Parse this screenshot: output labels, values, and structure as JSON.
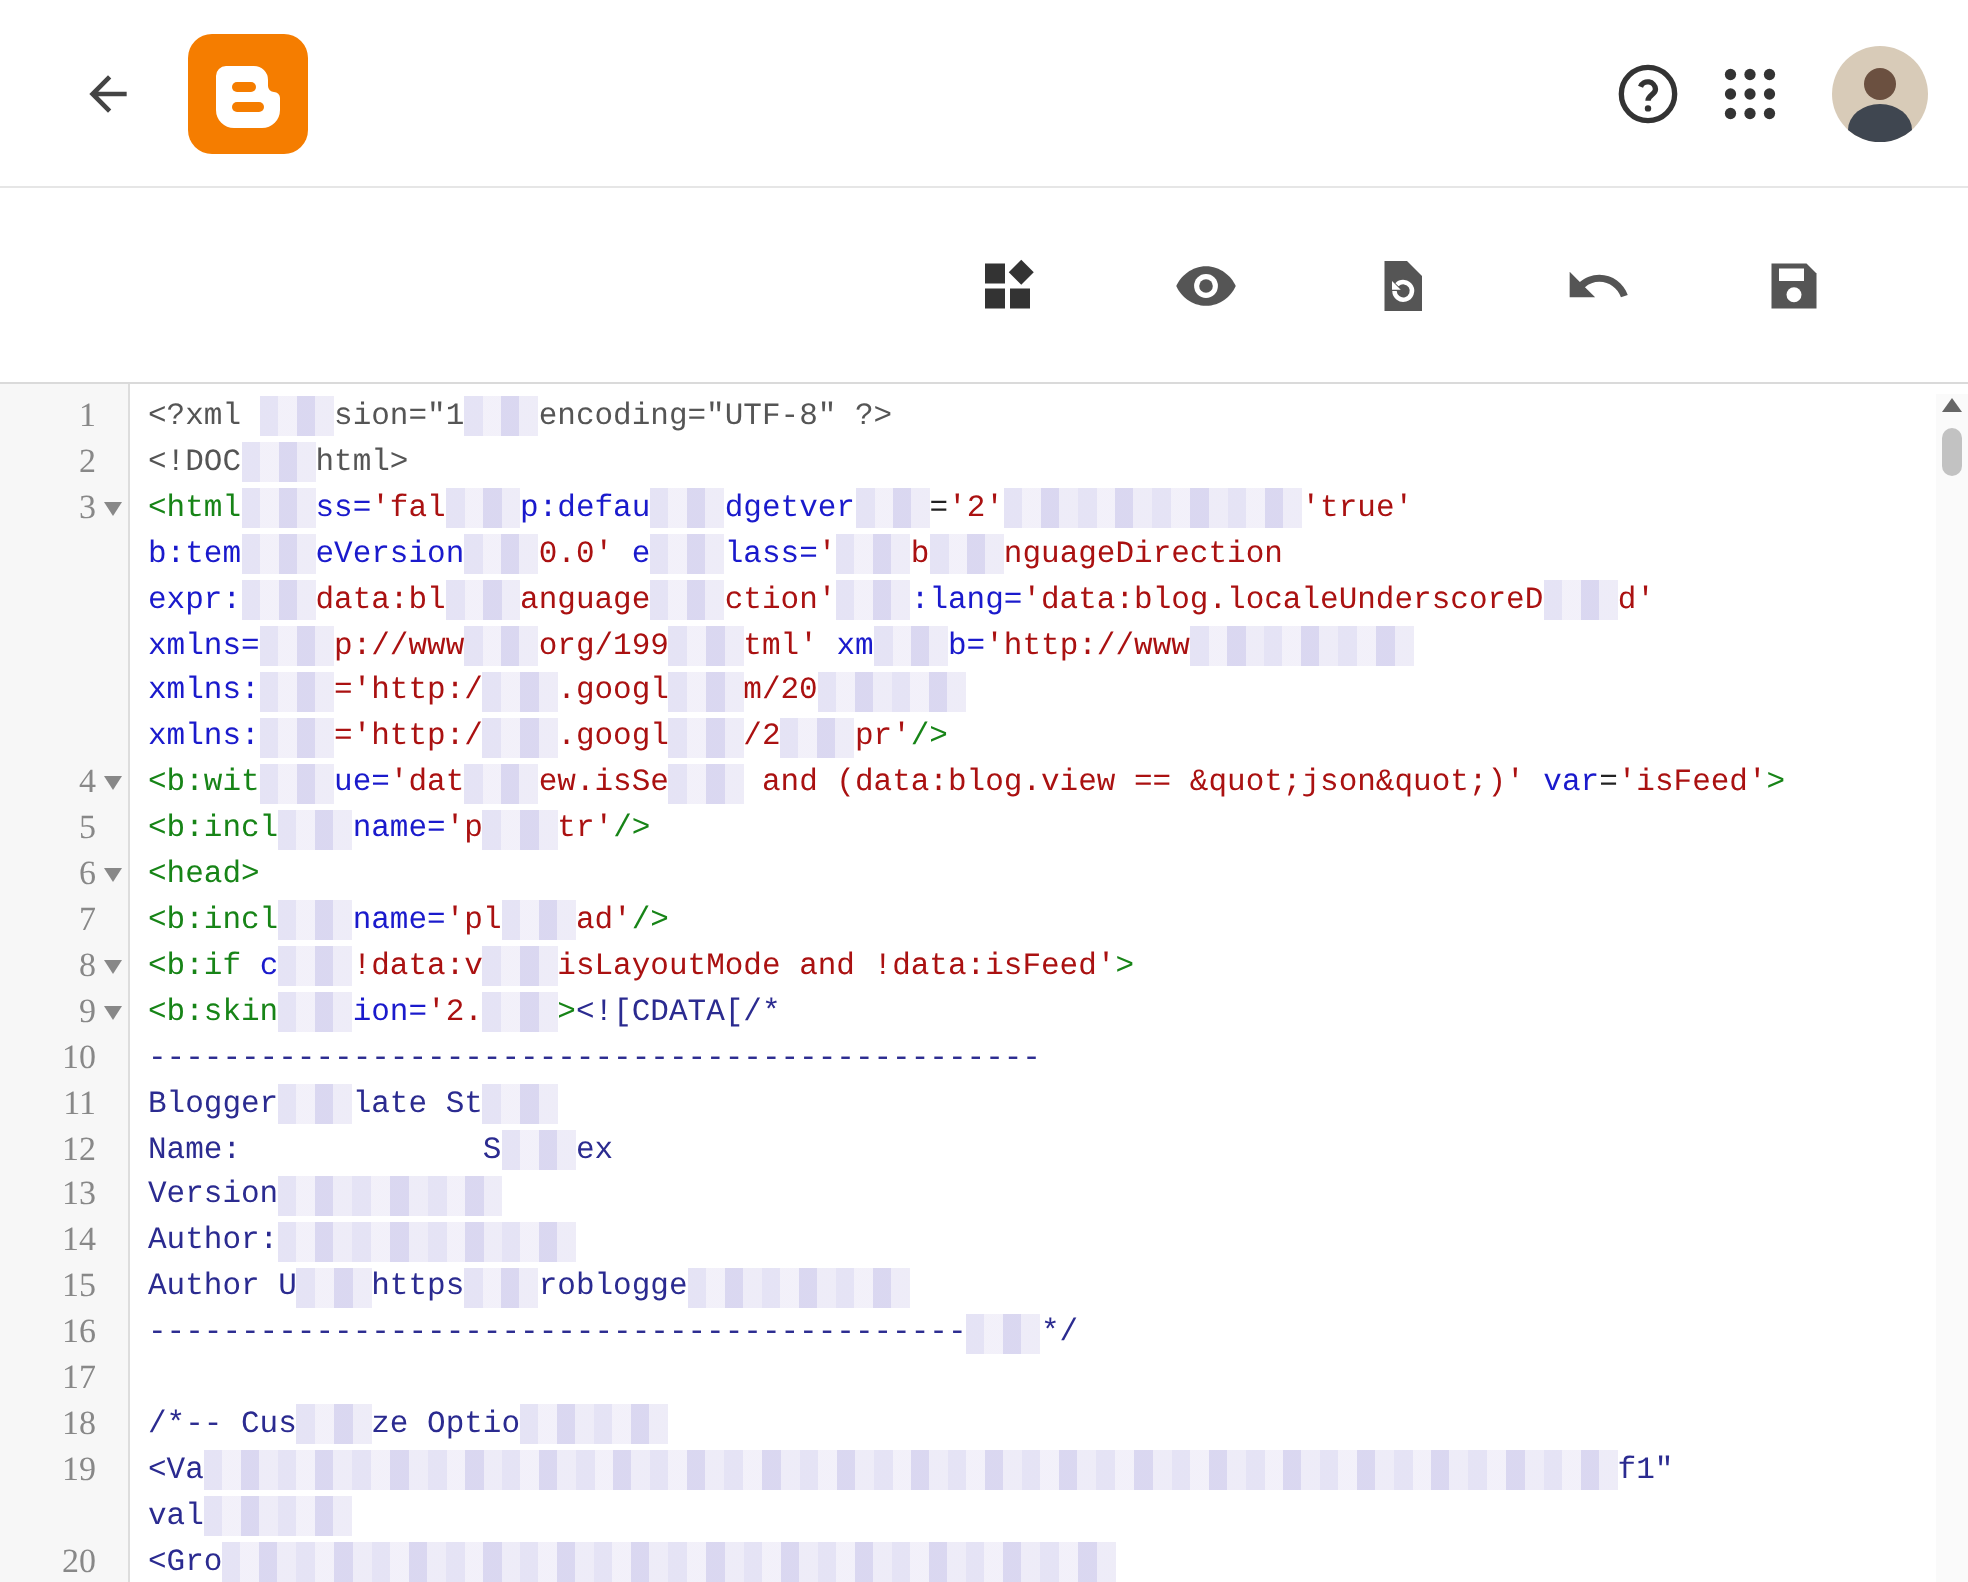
{
  "toolbar": [
    {
      "kind": "layout"
    },
    {
      "kind": "preview"
    },
    {
      "kind": "revert"
    },
    {
      "kind": "undo"
    },
    {
      "kind": "save"
    }
  ],
  "editor": {
    "lines": [
      {
        "number": "1",
        "fold": false,
        "segments": [
          {
            "kind": "meta",
            "text": "<?xml "
          },
          {
            "kind": "hidden"
          },
          {
            "kind": "meta",
            "text": "sion=\"1"
          },
          {
            "kind": "hidden"
          },
          {
            "kind": "meta",
            "text": "encoding=\"UTF-8\" ?>"
          }
        ]
      },
      {
        "number": "2",
        "fold": false,
        "segments": [
          {
            "kind": "meta",
            "text": "<!DOC"
          },
          {
            "kind": "hidden"
          },
          {
            "kind": "meta",
            "text": "html>"
          }
        ]
      },
      {
        "number": "3",
        "fold": true,
        "segments": [
          {
            "kind": "tag",
            "text": "<html"
          },
          {
            "kind": "hidden"
          },
          {
            "kind": "attr",
            "text": "ss="
          },
          {
            "kind": "string",
            "text": "'fal"
          },
          {
            "kind": "hidden"
          },
          {
            "kind": "attr",
            "text": "p:defau"
          },
          {
            "kind": "hidden"
          },
          {
            "kind": "attr",
            "text": "dgetver"
          },
          {
            "kind": "hidden"
          },
          {
            "kind": "plain",
            "text": "="
          },
          {
            "kind": "string",
            "text": "'2'"
          },
          {
            "kind": "hidden"
          },
          {
            "kind": "hidden"
          },
          {
            "kind": "hidden"
          },
          {
            "kind": "hidden"
          },
          {
            "kind": "string",
            "text": "'true'"
          }
        ]
      },
      {
        "segments": [
          {
            "kind": "attr",
            "text": "b:tem"
          },
          {
            "kind": "hidden"
          },
          {
            "kind": "attr",
            "text": "eVersion"
          },
          {
            "kind": "hidden"
          },
          {
            "kind": "string",
            "text": "0.0'"
          },
          {
            "kind": "attr",
            "text": " e"
          },
          {
            "kind": "hidden"
          },
          {
            "kind": "attr",
            "text": "lass="
          },
          {
            "kind": "string",
            "text": "'"
          },
          {
            "kind": "hidden"
          },
          {
            "kind": "string",
            "text": "b"
          },
          {
            "kind": "hidden"
          },
          {
            "kind": "string",
            "text": "nguageDirection"
          }
        ]
      },
      {
        "segments": [
          {
            "kind": "attr",
            "text": "expr:"
          },
          {
            "kind": "hidden"
          },
          {
            "kind": "string",
            "text": "data:bl"
          },
          {
            "kind": "hidden"
          },
          {
            "kind": "string",
            "text": "anguage"
          },
          {
            "kind": "hidden"
          },
          {
            "kind": "string",
            "text": "ction'"
          },
          {
            "kind": "hidden"
          },
          {
            "kind": "attr",
            "text": ":lang="
          },
          {
            "kind": "string",
            "text": "'data:blog.localeUnderscoreD"
          },
          {
            "kind": "hidden"
          },
          {
            "kind": "string",
            "text": "d'"
          }
        ]
      },
      {
        "segments": [
          {
            "kind": "attr",
            "text": "xmlns="
          },
          {
            "kind": "hidden"
          },
          {
            "kind": "string",
            "text": "p://www"
          },
          {
            "kind": "hidden"
          },
          {
            "kind": "string",
            "text": "org/199"
          },
          {
            "kind": "hidden"
          },
          {
            "kind": "string",
            "text": "tml'"
          },
          {
            "kind": "attr",
            "text": " xm"
          },
          {
            "kind": "hidden"
          },
          {
            "kind": "attr",
            "text": "b="
          },
          {
            "kind": "string",
            "text": "'http://www"
          },
          {
            "kind": "hidden"
          },
          {
            "kind": "hidden"
          },
          {
            "kind": "hidden"
          }
        ]
      },
      {
        "segments": [
          {
            "kind": "attr",
            "text": "xmlns:"
          },
          {
            "kind": "hidden"
          },
          {
            "kind": "string",
            "text": "='http:/"
          },
          {
            "kind": "hidden"
          },
          {
            "kind": "string",
            "text": ".googl"
          },
          {
            "kind": "hidden"
          },
          {
            "kind": "string",
            "text": "m/20"
          },
          {
            "kind": "hidden"
          },
          {
            "kind": "hidden"
          }
        ]
      },
      {
        "segments": [
          {
            "kind": "attr",
            "text": "xmlns:"
          },
          {
            "kind": "hidden"
          },
          {
            "kind": "string",
            "text": "='http:/"
          },
          {
            "kind": "hidden"
          },
          {
            "kind": "string",
            "text": ".googl"
          },
          {
            "kind": "hidden"
          },
          {
            "kind": "string",
            "text": "/2"
          },
          {
            "kind": "hidden"
          },
          {
            "kind": "string",
            "text": "pr'"
          },
          {
            "kind": "tag",
            "text": "/>"
          }
        ]
      },
      {
        "number": "4",
        "fold": true,
        "segments": [
          {
            "kind": "tag",
            "text": "<b:wit"
          },
          {
            "kind": "hidden"
          },
          {
            "kind": "attr",
            "text": "ue="
          },
          {
            "kind": "string",
            "text": "'dat"
          },
          {
            "kind": "hidden"
          },
          {
            "kind": "string",
            "text": "ew.isSe"
          },
          {
            "kind": "hidden"
          },
          {
            "kind": "string",
            "text": " and (data:blog.view == &quot;json&quot;)'"
          },
          {
            "kind": "attr",
            "text": " var"
          },
          {
            "kind": "plain",
            "text": "="
          },
          {
            "kind": "string",
            "text": "'isFeed'"
          },
          {
            "kind": "tag",
            "text": ">"
          }
        ]
      },
      {
        "number": "5",
        "fold": false,
        "segments": [
          {
            "kind": "tag",
            "text": "<b:incl"
          },
          {
            "kind": "hidden"
          },
          {
            "kind": "attr",
            "text": "name="
          },
          {
            "kind": "string",
            "text": "'p"
          },
          {
            "kind": "hidden"
          },
          {
            "kind": "string",
            "text": "tr'"
          },
          {
            "kind": "tag",
            "text": "/>"
          }
        ]
      },
      {
        "number": "6",
        "fold": true,
        "segments": [
          {
            "kind": "tag",
            "text": "<head>"
          }
        ]
      },
      {
        "number": "7",
        "fold": false,
        "segments": [
          {
            "kind": "tag",
            "text": "<b:incl"
          },
          {
            "kind": "hidden"
          },
          {
            "kind": "attr",
            "text": "name="
          },
          {
            "kind": "string",
            "text": "'pl"
          },
          {
            "kind": "hidden"
          },
          {
            "kind": "string",
            "text": "ad'"
          },
          {
            "kind": "tag",
            "text": "/>"
          }
        ]
      },
      {
        "number": "8",
        "fold": true,
        "segments": [
          {
            "kind": "tag",
            "text": "<b:if "
          },
          {
            "kind": "attr",
            "text": "c"
          },
          {
            "kind": "hidden"
          },
          {
            "kind": "string",
            "text": "!data:v"
          },
          {
            "kind": "hidden"
          },
          {
            "kind": "string",
            "text": "isLayoutMode and !data:isFeed'"
          },
          {
            "kind": "tag",
            "text": ">"
          }
        ]
      },
      {
        "number": "9",
        "fold": true,
        "segments": [
          {
            "kind": "tag",
            "text": "<b:skin"
          },
          {
            "kind": "hidden"
          },
          {
            "kind": "attr",
            "text": "ion="
          },
          {
            "kind": "string",
            "text": "'2."
          },
          {
            "kind": "hidden"
          },
          {
            "kind": "tag",
            "text": ">"
          },
          {
            "kind": "comment",
            "text": "<![CDATA[/*"
          }
        ]
      },
      {
        "number": "10",
        "fold": false,
        "segments": [
          {
            "kind": "comment",
            "text": "------------------------------------------------"
          }
        ]
      },
      {
        "number": "11",
        "fold": false,
        "segments": [
          {
            "kind": "comment",
            "text": "Blogger"
          },
          {
            "kind": "hidden"
          },
          {
            "kind": "comment",
            "text": "late St"
          },
          {
            "kind": "hidden"
          }
        ]
      },
      {
        "number": "12",
        "fold": false,
        "segments": [
          {
            "kind": "comment",
            "text": "Name:             S"
          },
          {
            "kind": "hidden"
          },
          {
            "kind": "comment",
            "text": "ex"
          }
        ]
      },
      {
        "number": "13",
        "fold": false,
        "segments": [
          {
            "kind": "comment",
            "text": "Version"
          },
          {
            "kind": "hidden"
          },
          {
            "kind": "hidden"
          },
          {
            "kind": "hidden"
          }
        ]
      },
      {
        "number": "14",
        "fold": false,
        "segments": [
          {
            "kind": "comment",
            "text": "Author:"
          },
          {
            "kind": "hidden"
          },
          {
            "kind": "hidden"
          },
          {
            "kind": "hidden"
          },
          {
            "kind": "hidden"
          }
        ]
      },
      {
        "number": "15",
        "fold": false,
        "segments": [
          {
            "kind": "comment",
            "text": "Author U"
          },
          {
            "kind": "hidden"
          },
          {
            "kind": "comment",
            "text": "https"
          },
          {
            "kind": "hidden"
          },
          {
            "kind": "comment",
            "text": "roblogge"
          },
          {
            "kind": "hidden"
          },
          {
            "kind": "hidden"
          },
          {
            "kind": "hidden"
          }
        ]
      },
      {
        "number": "16",
        "fold": false,
        "segments": [
          {
            "kind": "comment",
            "text": "--------------------------------------------"
          },
          {
            "kind": "hidden"
          },
          {
            "kind": "comment",
            "text": "*/"
          }
        ]
      },
      {
        "number": "17",
        "fold": false
      },
      {
        "number": "18",
        "fold": false,
        "segments": [
          {
            "kind": "comment",
            "text": "/*-- Cus"
          },
          {
            "kind": "hidden"
          },
          {
            "kind": "comment",
            "text": "ze Optio"
          },
          {
            "kind": "hidden"
          },
          {
            "kind": "hidden"
          }
        ]
      },
      {
        "number": "19",
        "fold": false,
        "segments": [
          {
            "kind": "comment",
            "text": "<Va"
          },
          {
            "kind": "hidden"
          },
          {
            "kind": "hidden"
          },
          {
            "kind": "hidden"
          },
          {
            "kind": "hidden"
          },
          {
            "kind": "hidden"
          },
          {
            "kind": "hidden"
          },
          {
            "kind": "hidden"
          },
          {
            "kind": "hidden"
          },
          {
            "kind": "hidden"
          },
          {
            "kind": "hidden"
          },
          {
            "kind": "hidden"
          },
          {
            "kind": "hidden"
          },
          {
            "kind": "hidden"
          },
          {
            "kind": "hidden"
          },
          {
            "kind": "hidden"
          },
          {
            "kind": "hidden"
          },
          {
            "kind": "hidden"
          },
          {
            "kind": "hidden"
          },
          {
            "kind": "hidden"
          },
          {
            "kind": "comment",
            "text": "f1\""
          }
        ]
      },
      {
        "segments": [
          {
            "kind": "comment",
            "text": "val"
          },
          {
            "kind": "hidden"
          },
          {
            "kind": "hidden"
          }
        ]
      },
      {
        "number": "20",
        "fold": false,
        "segments": [
          {
            "kind": "comment",
            "text": "<Gro"
          },
          {
            "kind": "hidden"
          },
          {
            "kind": "hidden"
          },
          {
            "kind": "hidden"
          },
          {
            "kind": "hidden"
          },
          {
            "kind": "hidden"
          },
          {
            "kind": "hidden"
          },
          {
            "kind": "hidden"
          },
          {
            "kind": "hidden"
          },
          {
            "kind": "hidden"
          },
          {
            "kind": "hidden"
          },
          {
            "kind": "hidden"
          },
          {
            "kind": "hidden"
          }
        ]
      }
    ]
  }
}
